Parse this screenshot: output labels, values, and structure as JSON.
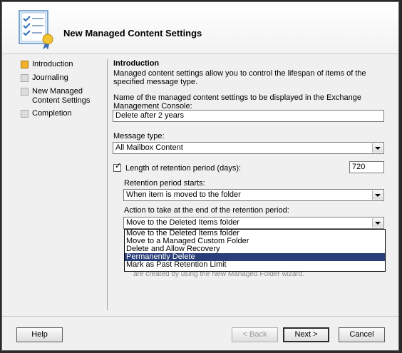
{
  "wizard": {
    "title": "New Managed Content Settings"
  },
  "sidebar": {
    "steps": [
      {
        "label": "Introduction",
        "active": true
      },
      {
        "label": "Journaling",
        "active": false
      },
      {
        "label": "New Managed Content Settings",
        "active": false
      },
      {
        "label": "Completion",
        "active": false
      }
    ]
  },
  "main": {
    "section_title": "Introduction",
    "description": "Managed content settings allow you to control the lifespan of items of the specified message type.",
    "name_label": "Name of the managed content settings to be displayed in the Exchange Management Console:",
    "name_value": "Delete after 2 years",
    "message_type_label": "Message type:",
    "message_type_value": "All Mailbox Content",
    "retention_checkbox_label": "Length of retention period (days):",
    "retention_checked": true,
    "retention_days": "720",
    "retention_start_label": "Retention period starts:",
    "retention_start_value": "When item is moved to the folder",
    "action_label": "Action to take at the end of the retention period:",
    "action_value": "Move to the Deleted Items folder",
    "action_options": [
      "Move to the Deleted Items folder",
      "Move to a Managed Custom Folder",
      "Delete and Allow Recovery",
      "Permanently Delete",
      "Mark as Past Retention Limit"
    ],
    "highlighted_option_index": 3,
    "obscured_text": "are created by using the New Managed Folder wizard."
  },
  "footer": {
    "help": "Help",
    "back": "< Back",
    "next": "Next >",
    "cancel": "Cancel"
  },
  "colors": {
    "highlight": "#2a3e7a",
    "active_step": "#f3b02a"
  },
  "icons": [
    "wizard-checklist-icon",
    "step-bullet-icon",
    "checkbox-check-icon",
    "chevron-down-icon"
  ]
}
